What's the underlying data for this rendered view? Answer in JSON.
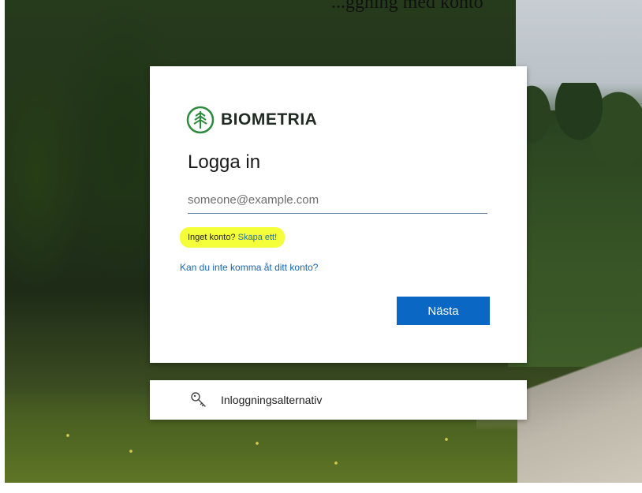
{
  "page": {
    "caption": "...ggning med konto"
  },
  "brand": {
    "logo_text": "BIOMETRIA",
    "color": "#2e8b3e"
  },
  "signin": {
    "title": "Logga in",
    "email_placeholder": "someone@example.com",
    "email_value": "",
    "no_account_text": "Inget konto?",
    "create_link": "Skapa ett!",
    "cant_access_link": "Kan du inte komma åt ditt konto?",
    "next_button": "Nästa",
    "accent_color": "#0a67c3",
    "highlight_color": "#f4ff3a"
  },
  "options": {
    "label": "Inloggningsalternativ",
    "icon": "key-icon"
  }
}
